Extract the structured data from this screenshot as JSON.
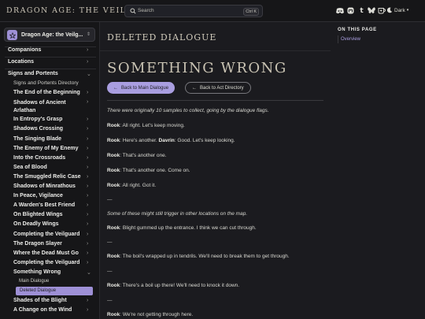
{
  "site": {
    "title": "DRAGON AGE: THE VEILGUARD"
  },
  "search": {
    "placeholder": "Search",
    "shortcut": "Ctrl K"
  },
  "header_icons": [
    "discord-icon",
    "mastodon-icon",
    "tumblr-icon",
    "bluesky-icon",
    "kofi-icon"
  ],
  "theme": {
    "label": "Dark"
  },
  "sidebar": {
    "project": "Dragon Age: the Veilg...",
    "sections": [
      {
        "label": "Companions"
      },
      {
        "label": "Locations"
      },
      {
        "label": "Signs and Portents"
      }
    ],
    "subheading": "Signs and Portents Directory",
    "items": [
      "The End of the Beginning",
      "Shadows of Ancient Arlathan",
      "In Entropy's Grasp",
      "Shadows Crossing",
      "The Singing Blade",
      "The Enemy of My Enemy",
      "Into the Crossroads",
      "Sea of Blood",
      "The Smuggled Relic Case",
      "Shadows of Minrathous",
      "In Peace, Vigilance",
      "A Warden's Best Friend",
      "On Blighted Wings",
      "On Deadly Wings",
      "Completing the Veilguard",
      "The Dragon Slayer",
      "Where the Dead Must Go",
      "Completing the Veilguard",
      "Something Wrong",
      "Shades of the Blight",
      "A Change on the Wind"
    ],
    "sub_items": [
      "Main Dialogue",
      "Deleted Dialogue"
    ]
  },
  "main": {
    "breadcrumb_title": "DELETED DIALOGUE",
    "title": "SOMETHING WRONG",
    "btn_main": "Back to Main Dialogue",
    "btn_act": "Back to Act Directory",
    "lines": {
      "intro": "There were originally 10 samples to collect, going by the dialogue flags.",
      "l1_speaker": "Rook",
      "l1_text": ": All right. Let's keep moving.",
      "l2_speaker": "Rook",
      "l2_text": ": Here's another. ",
      "l2_speaker2": "Davrin",
      "l2_text2": ": Good. Let's keep looking.",
      "l3_speaker": "Rook",
      "l3_text": ": That's another one.",
      "l4_speaker": "Rook",
      "l4_text": ": That's another one. Come on.",
      "l5_speaker": "Rook",
      "l5_text": ": All right. Got it.",
      "dash": "—",
      "note": "Some of these might still trigger in other locations on the map.",
      "l6_speaker": "Rook",
      "l6_text": ": Blight gummed up the entrance. I think we can cut through.",
      "l7_speaker": "Rook",
      "l7_text": ": The boil's wrapped up in tendrils. We'll need to break them to get through.",
      "l8_speaker": "Rook",
      "l8_text": ": There's a boil up there! We'll need to knock it down.",
      "l9_speaker": "Rook",
      "l9_text": ": We're not getting through here."
    }
  },
  "toc": {
    "title": "ON THIS PAGE",
    "items": [
      "Overview"
    ]
  },
  "colors": {
    "accent": "#a99ee0",
    "background": "#1b1b1f",
    "sidebar": "#161618"
  }
}
